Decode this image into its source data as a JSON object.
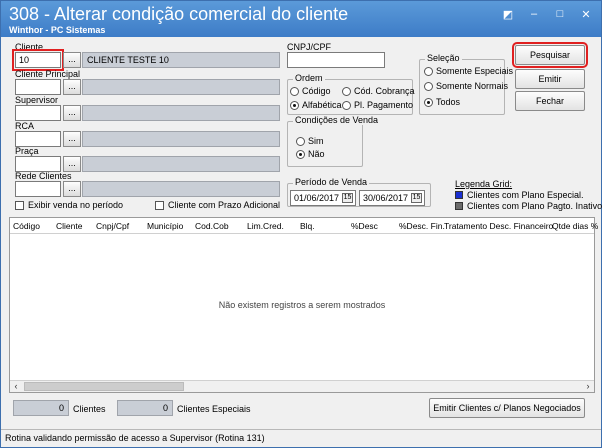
{
  "window": {
    "title": "308 - Alterar condição comercial do cliente",
    "subtitle": "Winthor - PC Sistemas",
    "controls": [
      "◩",
      "–",
      "□",
      "✕"
    ]
  },
  "filters": {
    "cliente": {
      "label": "Cliente",
      "code": "10",
      "name": "CLIENTE TESTE 10"
    },
    "cliente_principal": {
      "label": "Cliente Principal",
      "code": "",
      "name": ""
    },
    "supervisor": {
      "label": "Supervisor",
      "code": "",
      "name": ""
    },
    "rca": {
      "label": "RCA",
      "code": "",
      "name": ""
    },
    "praca": {
      "label": "Praça",
      "code": "",
      "name": ""
    },
    "rede_clientes": {
      "label": "Rede Clientes",
      "code": "",
      "name": ""
    },
    "dots": "...",
    "exibir_venda": "Exibir venda no período",
    "prazo_adicional": "Cliente com Prazo Adicional"
  },
  "cnpj": {
    "label": "CNPJ/CPF",
    "value": ""
  },
  "ordem": {
    "title": "Ordem",
    "options": [
      "Código",
      "Cód. Cobrança",
      "Alfabética",
      "Pl. Pagamento"
    ],
    "selected": "Alfabética"
  },
  "selecao": {
    "title": "Seleção",
    "options": [
      "Somente Especiais",
      "Somente Normais",
      "Todos"
    ],
    "selected": "Todos"
  },
  "condicoes": {
    "title": "Condições de Venda",
    "options": [
      "Sim",
      "Não"
    ],
    "selected": "Não"
  },
  "periodo": {
    "title": "Período de Venda",
    "start": "01/06/2017",
    "end": "30/06/2017",
    "cal_icon": "15"
  },
  "buttons": {
    "pesquisar": "Pesquisar",
    "emitir": "Emitir",
    "fechar": "Fechar",
    "emitir_clientes": "Emitir Clientes c/ Planos Negociados"
  },
  "legend": {
    "title": "Legenda Grid:",
    "items": [
      {
        "label": "Clientes com Plano Especial.",
        "color": "#1a2fd1"
      },
      {
        "label": "Clientes com Plano Pagto. Inativo.",
        "color": "#6b6b6b"
      }
    ]
  },
  "grid": {
    "columns": [
      "Código",
      "Cliente",
      "Cnpj/Cpf",
      "Município",
      "Cod.Cob",
      "Lim.Cred.",
      "Blq.",
      "%Desc",
      "%Desc. Fin.",
      "Tratamento Desc. Financeiro",
      "Qtde dias %"
    ],
    "empty_text": "Não existem registros a serem mostrados",
    "scroll_left": "‹",
    "scroll_right": "›"
  },
  "footer": {
    "clientes_count": "0",
    "clientes_label": "Clientes",
    "especiais_count": "0",
    "especiais_label": "Clientes Especiais"
  },
  "status": "Rotina validando permissão de acesso a Supervisor (Rotina 131)"
}
